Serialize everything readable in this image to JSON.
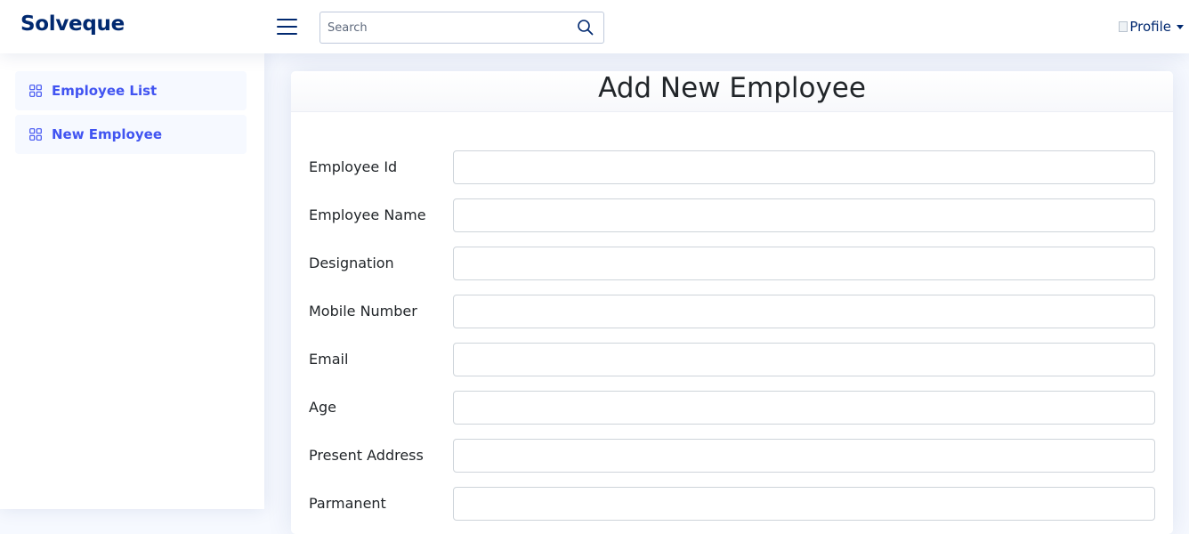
{
  "header": {
    "logo": "Solveque",
    "search": {
      "placeholder": "Search",
      "value": ""
    },
    "profile": {
      "label": "Profile"
    }
  },
  "sidebar": {
    "items": [
      {
        "label": "Employee List",
        "icon": "grid-icon"
      },
      {
        "label": "New Employee",
        "icon": "grid-icon"
      }
    ]
  },
  "main": {
    "title": "Add New Employee",
    "fields": [
      {
        "label": "Employee Id",
        "value": ""
      },
      {
        "label": "Employee Name",
        "value": ""
      },
      {
        "label": "Designation",
        "value": ""
      },
      {
        "label": "Mobile Number",
        "value": ""
      },
      {
        "label": "Email",
        "value": ""
      },
      {
        "label": "Age",
        "value": ""
      },
      {
        "label": "Present Address",
        "value": ""
      },
      {
        "label": "Parmanent",
        "value": ""
      }
    ]
  },
  "colors": {
    "brand": "#012970",
    "accent": "#4154f1",
    "background": "#f6f9ff"
  }
}
